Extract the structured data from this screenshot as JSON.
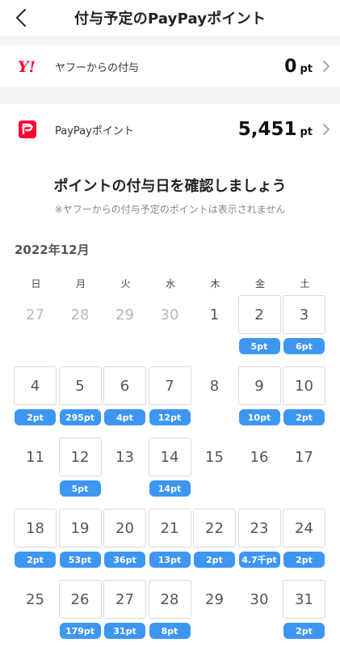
{
  "header": {
    "title": "付与予定のPayPayポイント"
  },
  "yahoo": {
    "logo_text": "Y!",
    "label": "ヤフーからの付与",
    "value": "0",
    "unit": "pt"
  },
  "paypay": {
    "label": "PayPayポイント",
    "value": "5,451",
    "unit": "pt"
  },
  "calendar": {
    "heading": "ポイントの付与日を確認しましょう",
    "note": "※ヤフーからの付与予定のポイントは表示されません",
    "month": "2022年12月",
    "weekdays": [
      "日",
      "月",
      "火",
      "水",
      "木",
      "金",
      "土"
    ],
    "days": [
      {
        "d": "27",
        "muted": true,
        "boxed": false,
        "pt": ""
      },
      {
        "d": "28",
        "muted": true,
        "boxed": false,
        "pt": ""
      },
      {
        "d": "29",
        "muted": true,
        "boxed": false,
        "pt": ""
      },
      {
        "d": "30",
        "muted": true,
        "boxed": false,
        "pt": ""
      },
      {
        "d": "1",
        "muted": false,
        "boxed": false,
        "pt": ""
      },
      {
        "d": "2",
        "muted": false,
        "boxed": true,
        "pt": "5pt"
      },
      {
        "d": "3",
        "muted": false,
        "boxed": true,
        "pt": "6pt"
      },
      {
        "d": "4",
        "muted": false,
        "boxed": true,
        "pt": "2pt"
      },
      {
        "d": "5",
        "muted": false,
        "boxed": true,
        "pt": "295pt"
      },
      {
        "d": "6",
        "muted": false,
        "boxed": true,
        "pt": "4pt"
      },
      {
        "d": "7",
        "muted": false,
        "boxed": true,
        "pt": "12pt"
      },
      {
        "d": "8",
        "muted": false,
        "boxed": false,
        "pt": ""
      },
      {
        "d": "9",
        "muted": false,
        "boxed": true,
        "pt": "10pt"
      },
      {
        "d": "10",
        "muted": false,
        "boxed": true,
        "pt": "2pt"
      },
      {
        "d": "11",
        "muted": false,
        "boxed": false,
        "pt": ""
      },
      {
        "d": "12",
        "muted": false,
        "boxed": true,
        "pt": "5pt"
      },
      {
        "d": "13",
        "muted": false,
        "boxed": false,
        "pt": ""
      },
      {
        "d": "14",
        "muted": false,
        "boxed": true,
        "pt": "14pt"
      },
      {
        "d": "15",
        "muted": false,
        "boxed": false,
        "pt": ""
      },
      {
        "d": "16",
        "muted": false,
        "boxed": false,
        "pt": ""
      },
      {
        "d": "17",
        "muted": false,
        "boxed": false,
        "pt": ""
      },
      {
        "d": "18",
        "muted": false,
        "boxed": true,
        "pt": "2pt"
      },
      {
        "d": "19",
        "muted": false,
        "boxed": true,
        "pt": "53pt"
      },
      {
        "d": "20",
        "muted": false,
        "boxed": true,
        "pt": "36pt"
      },
      {
        "d": "21",
        "muted": false,
        "boxed": true,
        "pt": "13pt"
      },
      {
        "d": "22",
        "muted": false,
        "boxed": true,
        "pt": "2pt"
      },
      {
        "d": "23",
        "muted": false,
        "boxed": true,
        "pt": "4.7千pt"
      },
      {
        "d": "24",
        "muted": false,
        "boxed": true,
        "pt": "2pt"
      },
      {
        "d": "25",
        "muted": false,
        "boxed": false,
        "pt": ""
      },
      {
        "d": "26",
        "muted": false,
        "boxed": true,
        "pt": "179pt"
      },
      {
        "d": "27",
        "muted": false,
        "boxed": true,
        "pt": "31pt"
      },
      {
        "d": "28",
        "muted": false,
        "boxed": true,
        "pt": "8pt"
      },
      {
        "d": "29",
        "muted": false,
        "boxed": false,
        "pt": ""
      },
      {
        "d": "30",
        "muted": false,
        "boxed": false,
        "pt": ""
      },
      {
        "d": "31",
        "muted": false,
        "boxed": true,
        "pt": "2pt"
      }
    ]
  },
  "colors": {
    "accent": "#3e96f3",
    "yahoo_red": "#ff0033",
    "paypay_red": "#ff0033"
  },
  "icons": {
    "back": "back-chevron-icon",
    "row_chevron": "chevron-right-icon",
    "yahoo": "yahoo-logo-icon",
    "paypay": "paypay-logo-icon"
  }
}
